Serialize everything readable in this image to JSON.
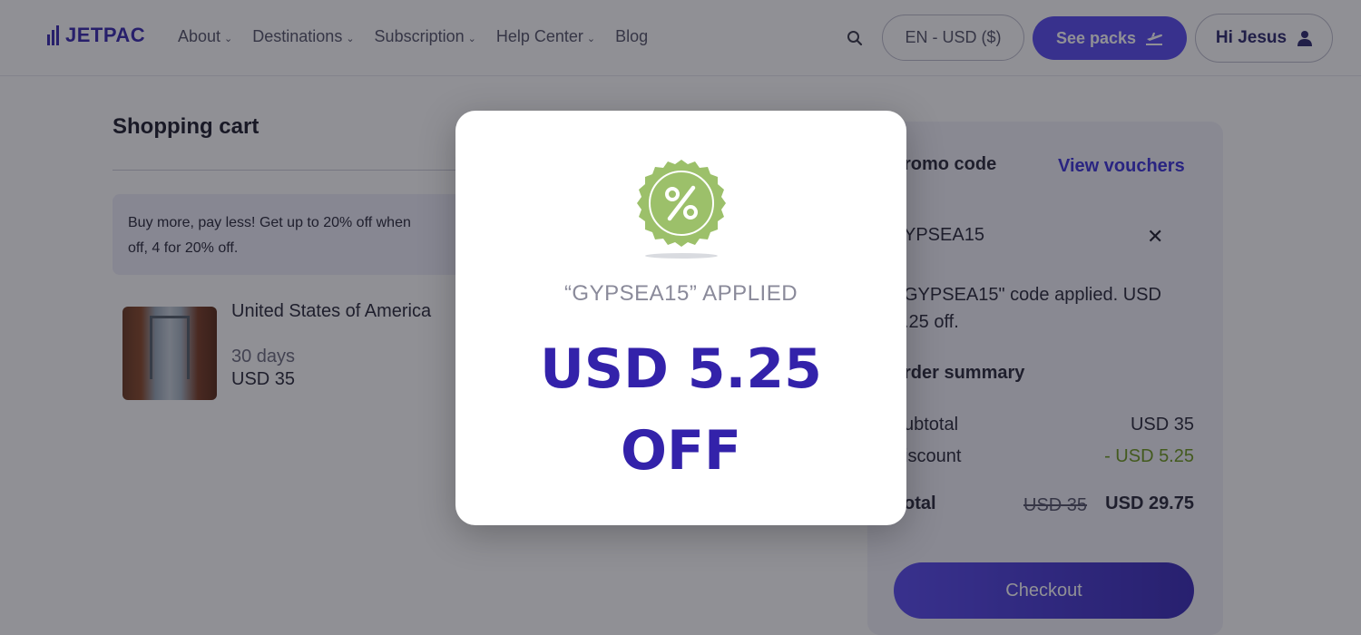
{
  "header": {
    "logo_text": "JETPAC",
    "nav": [
      {
        "label": "About",
        "has_dropdown": true
      },
      {
        "label": "Destinations",
        "has_dropdown": true
      },
      {
        "label": "Subscription",
        "has_dropdown": true
      },
      {
        "label": "Help Center",
        "has_dropdown": true
      },
      {
        "label": "Blog",
        "has_dropdown": false
      }
    ],
    "search_icon": "search-icon",
    "locale_label": "EN - USD ($)",
    "packs_label": "See packs",
    "packs_icon": "plane-departure-icon",
    "user_greeting": "Hi Jesus",
    "user_icon": "user-icon"
  },
  "cart": {
    "title": "Shopping cart",
    "promo_banner_line1": "Buy more, pay less! Get up to 20% off when",
    "promo_banner_line2": "off, 4 for 20% off.",
    "item": {
      "name": "United States of America",
      "duration": "30 days",
      "price": "USD 35"
    }
  },
  "summary": {
    "promo_heading": "romo code",
    "view_vouchers": "View vouchers",
    "applied_code": "YPSEA15",
    "applied_message_line1": "GYPSEA15\" code applied. USD",
    "applied_message_line2": ".25 off.",
    "order_heading": "rder summary",
    "subtotal_label": "ubtotal",
    "subtotal_value": "USD 35",
    "discount_label": "iscount",
    "discount_value": "- USD 5.25",
    "total_label": "otal",
    "total_original": "USD 35",
    "total_value": "USD 29.75",
    "checkout_label": "Checkout"
  },
  "modal": {
    "badge_icon": "percent-badge-icon",
    "applied_text": "“GYPSEA15” APPLIED",
    "amount_line1": "USD 5.25",
    "amount_line2": "OFF"
  },
  "colors": {
    "brand": "#5a4cf0",
    "brand_dark": "#3322aa",
    "discount_green": "#6f9a1f",
    "badge_green": "#9cc06a"
  }
}
